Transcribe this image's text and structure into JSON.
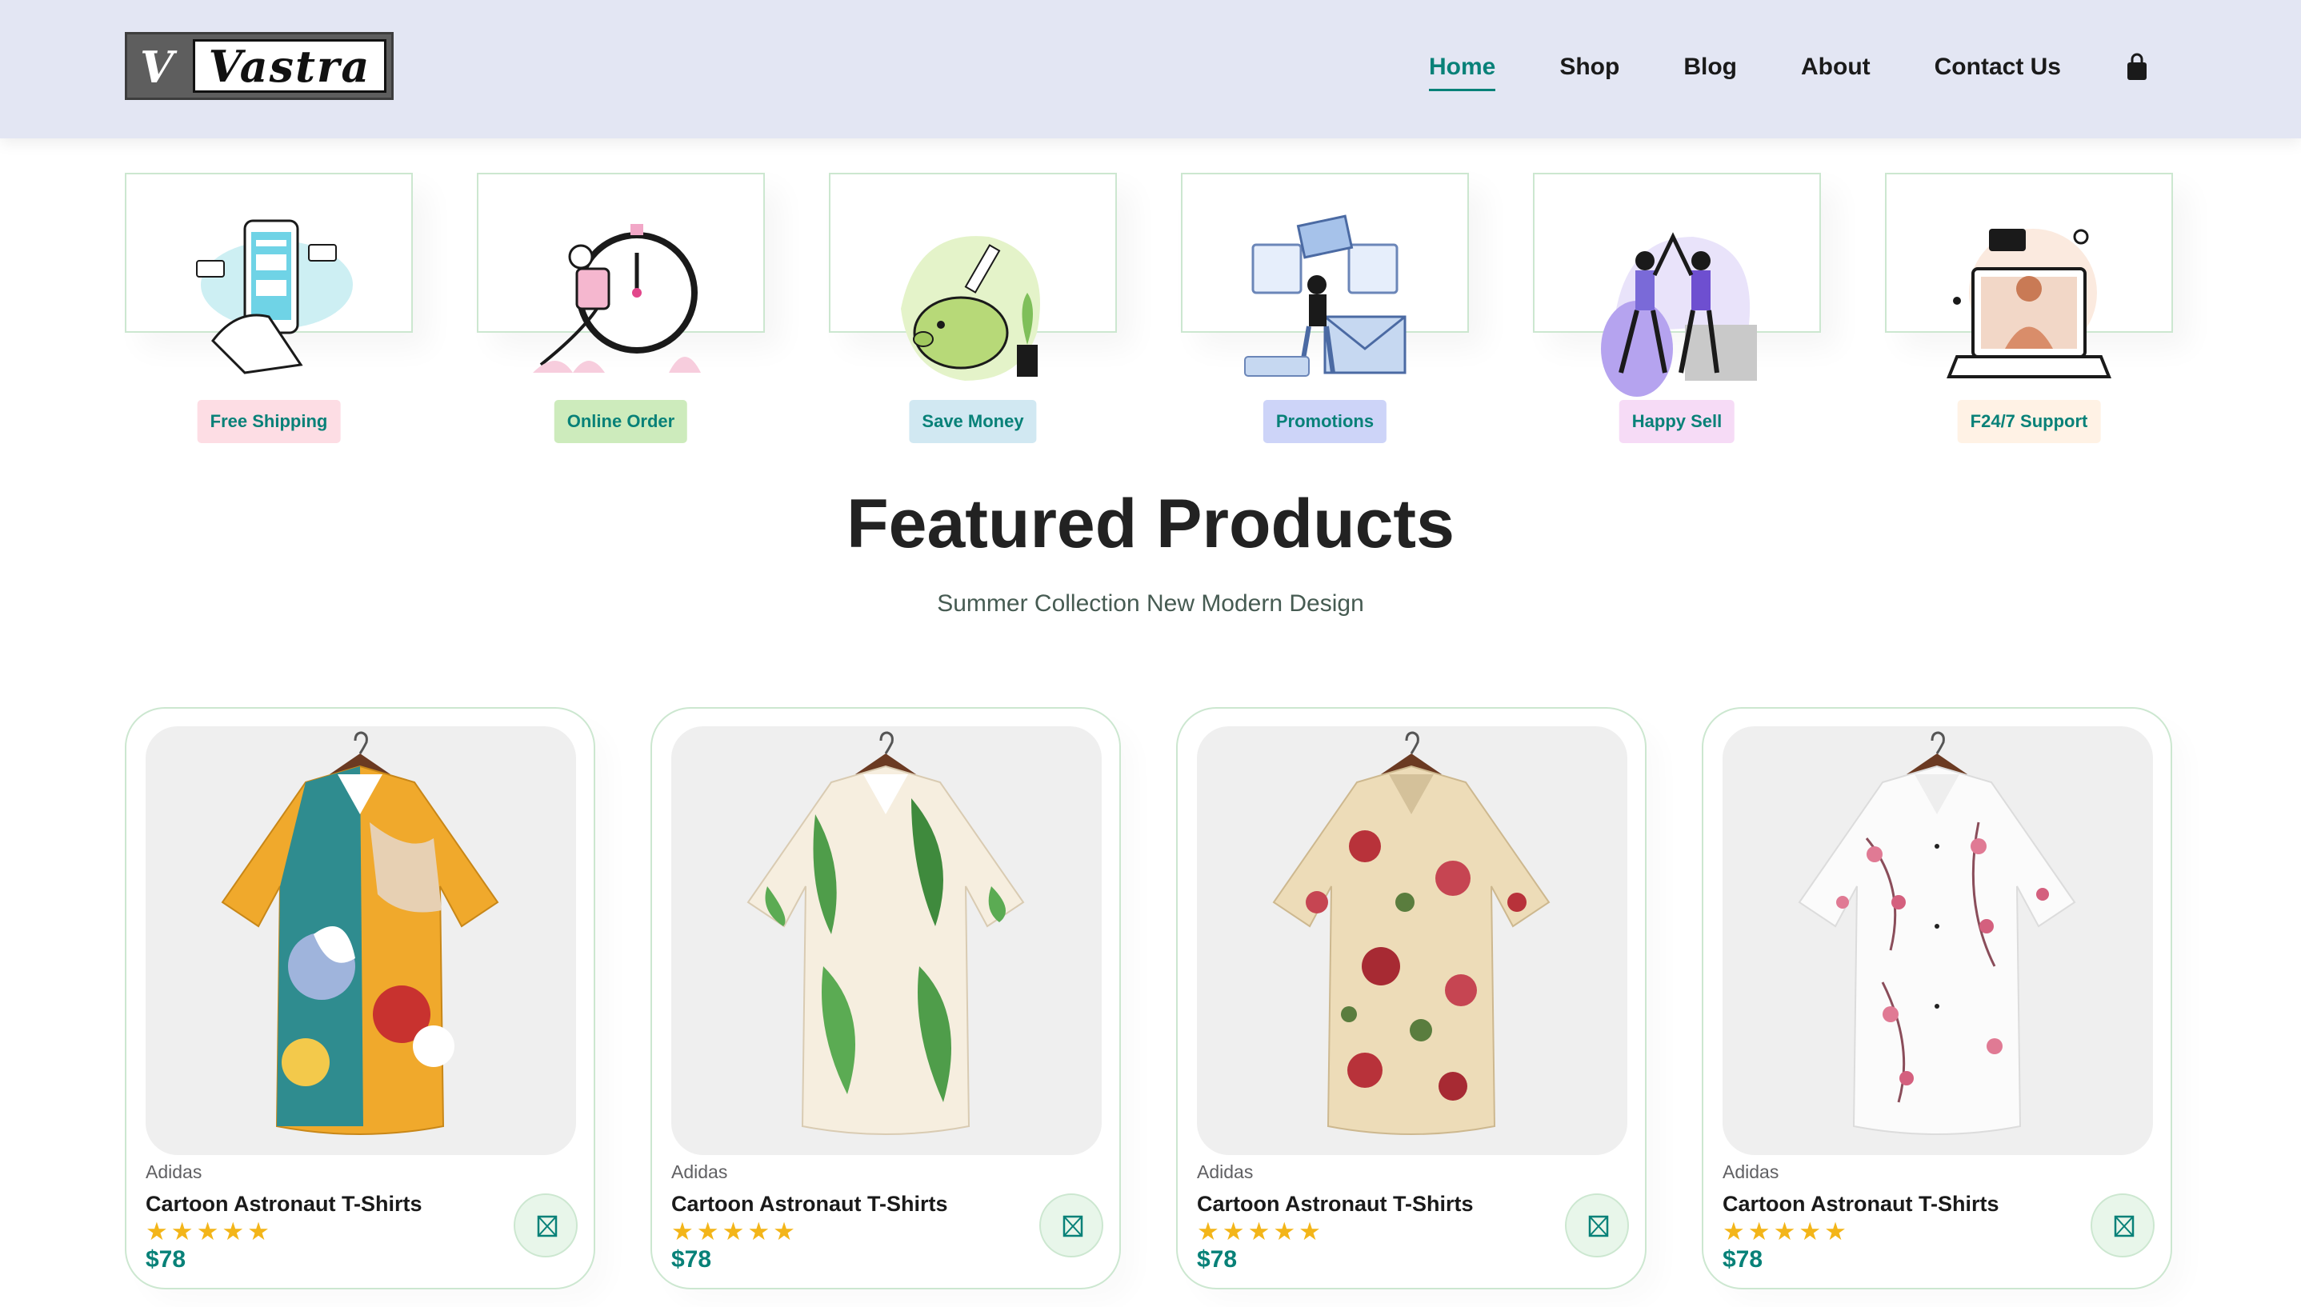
{
  "brand": {
    "logo_letter": "V",
    "logo_text": "Vastra"
  },
  "nav": {
    "items": [
      {
        "label": "Home",
        "active": true
      },
      {
        "label": "Shop",
        "active": false
      },
      {
        "label": "Blog",
        "active": false
      },
      {
        "label": "About",
        "active": false
      },
      {
        "label": "Contact Us",
        "active": false
      }
    ],
    "cart_icon": "shopping-bag-icon"
  },
  "features": [
    {
      "label": "Free Shipping",
      "badge_color": "#fddde4",
      "icon": "phone-payment-illustration"
    },
    {
      "label": "Online Order",
      "badge_color": "#cdebbc",
      "icon": "stopwatch-courier-illustration"
    },
    {
      "label": "Save Money",
      "badge_color": "#d1e8f2",
      "icon": "piggy-bank-illustration"
    },
    {
      "label": "Promotions",
      "badge_color": "#cdd4f8",
      "icon": "promotion-window-illustration"
    },
    {
      "label": "Happy Sell",
      "badge_color": "#f6dbf6",
      "icon": "high-five-illustration"
    },
    {
      "label": "F24/7 Support",
      "badge_color": "#fff2e5",
      "icon": "laptop-support-illustration"
    }
  ],
  "section": {
    "title": "Featured Products",
    "subtitle": "Summer Collection New Modern Design"
  },
  "products": [
    {
      "brand": "Adidas",
      "name": "Cartoon Astronaut T-Shirts",
      "rating": 5,
      "stars": "★★★★★",
      "price": "$78",
      "pattern": "abstract-multicolor-shirt"
    },
    {
      "brand": "Adidas",
      "name": "Cartoon Astronaut T-Shirts",
      "rating": 5,
      "stars": "★★★★★",
      "price": "$78",
      "pattern": "green-leaf-shirt"
    },
    {
      "brand": "Adidas",
      "name": "Cartoon Astronaut T-Shirts",
      "rating": 5,
      "stars": "★★★★★",
      "price": "$78",
      "pattern": "beige-floral-shirt"
    },
    {
      "brand": "Adidas",
      "name": "Cartoon Astronaut T-Shirts",
      "rating": 5,
      "stars": "★★★★★",
      "price": "$78",
      "pattern": "white-pink-blossom-shirt"
    }
  ],
  "colors": {
    "accent": "#088178",
    "header_bg": "#e3e6f3",
    "star": "#f3b519"
  }
}
